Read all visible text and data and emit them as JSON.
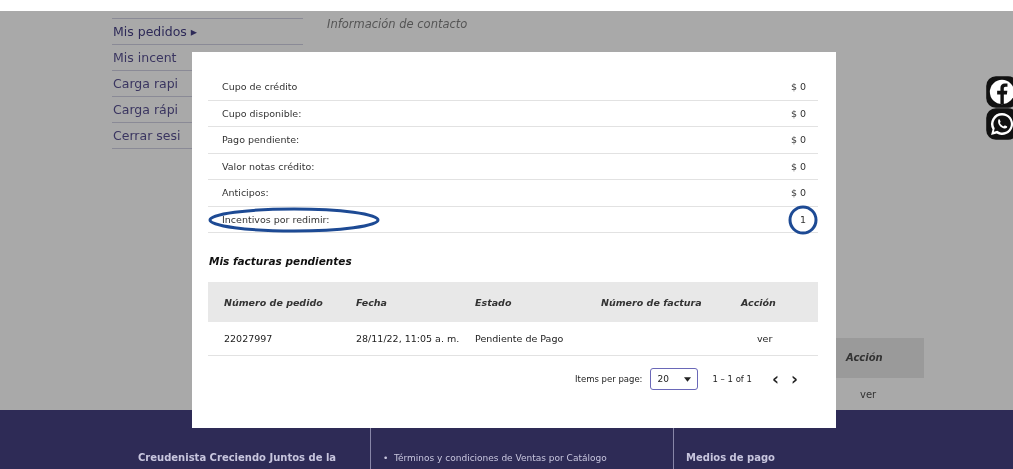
{
  "sidebar": {
    "items": [
      {
        "label": "Mis pedidos",
        "arrow": "▸",
        "selected": true
      },
      {
        "label": "Mis incent",
        "selected": false
      },
      {
        "label": "Carga rapi",
        "selected": false
      },
      {
        "label": "Carga rápi",
        "selected": false
      },
      {
        "label": "Cerrar sesi",
        "selected": false
      }
    ]
  },
  "contact_heading": "Información de contacto",
  "background_table": {
    "header": "Acción",
    "cell": "ver"
  },
  "footer": {
    "bullet": "•",
    "columns": [
      "Creudenista Creciendo Juntos de la",
      "Términos y condiciones de Ventas por Catálogo",
      "Medios de pago"
    ]
  },
  "modal": {
    "summary": [
      {
        "label": "Cupo de crédito",
        "value": "$ 0",
        "highlighted": false
      },
      {
        "label": "Cupo disponible:",
        "value": "$ 0",
        "highlighted": false
      },
      {
        "label": "Pago pendiente:",
        "value": "$ 0",
        "highlighted": false
      },
      {
        "label": "Valor notas crédito:",
        "value": "$ 0",
        "highlighted": false
      },
      {
        "label": "Anticipos:",
        "value": "$ 0",
        "highlighted": false
      },
      {
        "label": "Incentivos por redimir:",
        "value": "1",
        "highlighted": true
      }
    ],
    "invoices_title": "Mis facturas pendientes",
    "table": {
      "columns": [
        "Número de pedido",
        "Fecha",
        "Estado",
        "Número de factura",
        "Acción"
      ],
      "rows": [
        [
          "22027997",
          "28/11/22, 11:05 a. m.",
          "Pendiente de Pago",
          "",
          "ver"
        ]
      ]
    },
    "paginator": {
      "items_label": "Items per page:",
      "page_size": "20",
      "range": "1 – 1 of 1",
      "prev": "‹",
      "next": "›"
    }
  }
}
